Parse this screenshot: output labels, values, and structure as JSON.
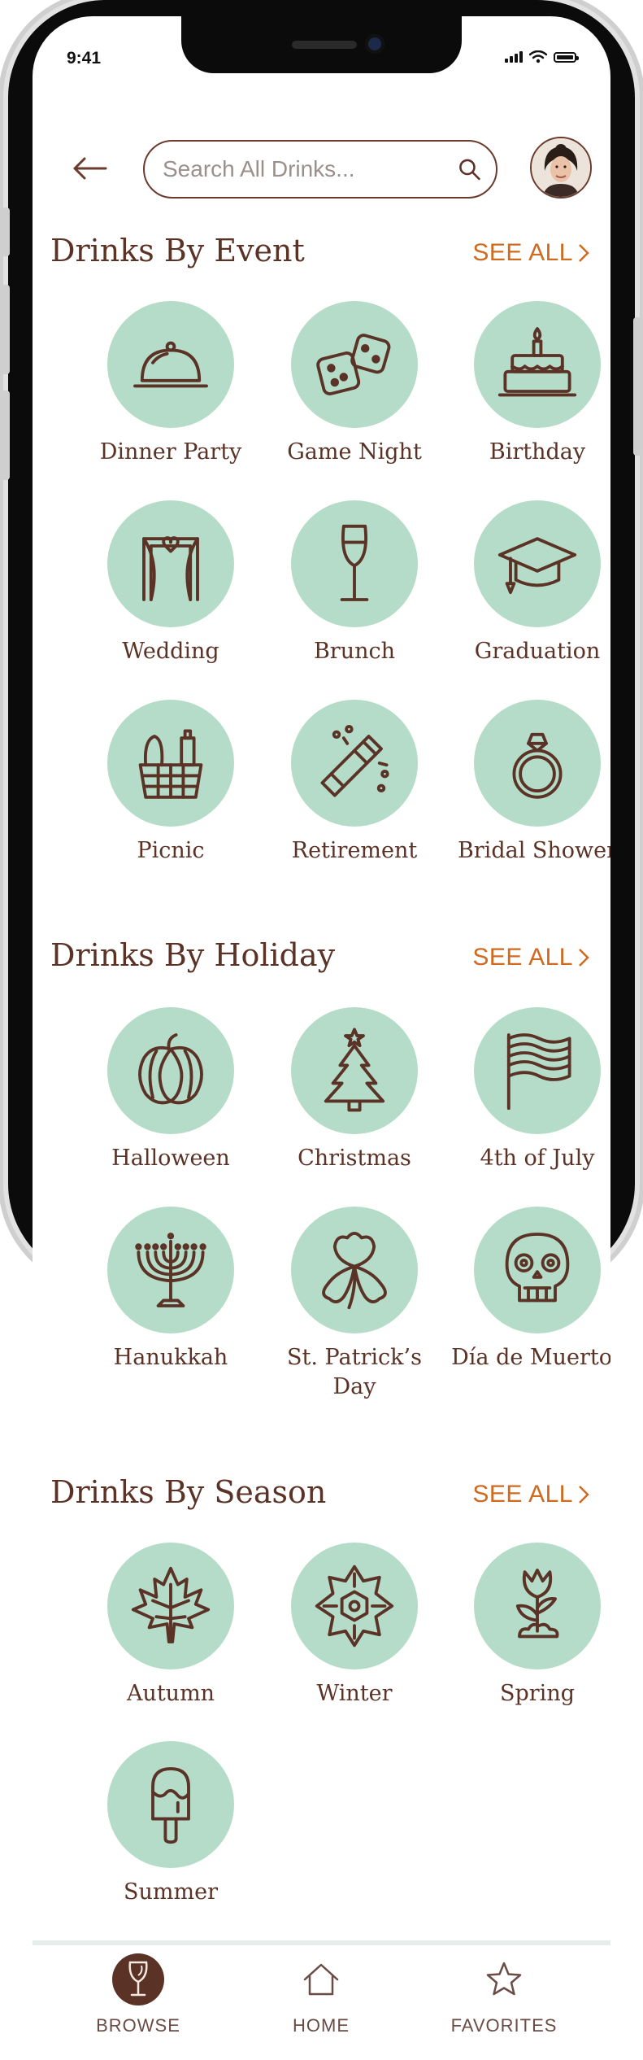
{
  "status": {
    "time": "9:41"
  },
  "search": {
    "placeholder": "Search All Drinks..."
  },
  "sections": [
    {
      "title": "Drinks By Event",
      "see_all": "SEE ALL",
      "items": [
        {
          "label": "Dinner Party",
          "icon": "cloche-icon"
        },
        {
          "label": "Game Night",
          "icon": "dice-icon"
        },
        {
          "label": "Birthday",
          "icon": "cake-icon"
        },
        {
          "label": "Wedding",
          "icon": "wedding-arch-icon"
        },
        {
          "label": "Brunch",
          "icon": "champagne-flute-icon"
        },
        {
          "label": "Graduation",
          "icon": "graduation-cap-icon"
        },
        {
          "label": "Picnic",
          "icon": "picnic-basket-icon"
        },
        {
          "label": "Retirement",
          "icon": "champagne-bottle-icon"
        },
        {
          "label": "Bridal Shower",
          "icon": "ring-icon"
        }
      ]
    },
    {
      "title": "Drinks By Holiday",
      "see_all": "SEE ALL",
      "items": [
        {
          "label": "Halloween",
          "icon": "pumpkin-icon"
        },
        {
          "label": "Christmas",
          "icon": "christmas-tree-icon"
        },
        {
          "label": "4th of July",
          "icon": "flag-icon"
        },
        {
          "label": "Hanukkah",
          "icon": "menorah-icon"
        },
        {
          "label": "St. Patrick’s Day",
          "icon": "clover-icon"
        },
        {
          "label": "Día de Muertos",
          "icon": "sugar-skull-icon"
        }
      ]
    },
    {
      "title": "Drinks By Season",
      "see_all": "SEE ALL",
      "items": [
        {
          "label": "Autumn",
          "icon": "maple-leaf-icon"
        },
        {
          "label": "Winter",
          "icon": "snowflake-icon"
        },
        {
          "label": "Spring",
          "icon": "tulip-icon"
        },
        {
          "label": "Summer",
          "icon": "popsicle-icon"
        }
      ]
    }
  ],
  "tabbar": {
    "items": [
      {
        "label": "BROWSE",
        "icon": "wine-glass-icon",
        "active": true
      },
      {
        "label": "HOME",
        "icon": "home-icon",
        "active": false
      },
      {
        "label": "FAVORITES",
        "icon": "star-icon",
        "active": false
      }
    ]
  },
  "colors": {
    "accent": "#d06a1f",
    "heading": "#5b3226",
    "icon_circle": "#b4dcc8"
  }
}
